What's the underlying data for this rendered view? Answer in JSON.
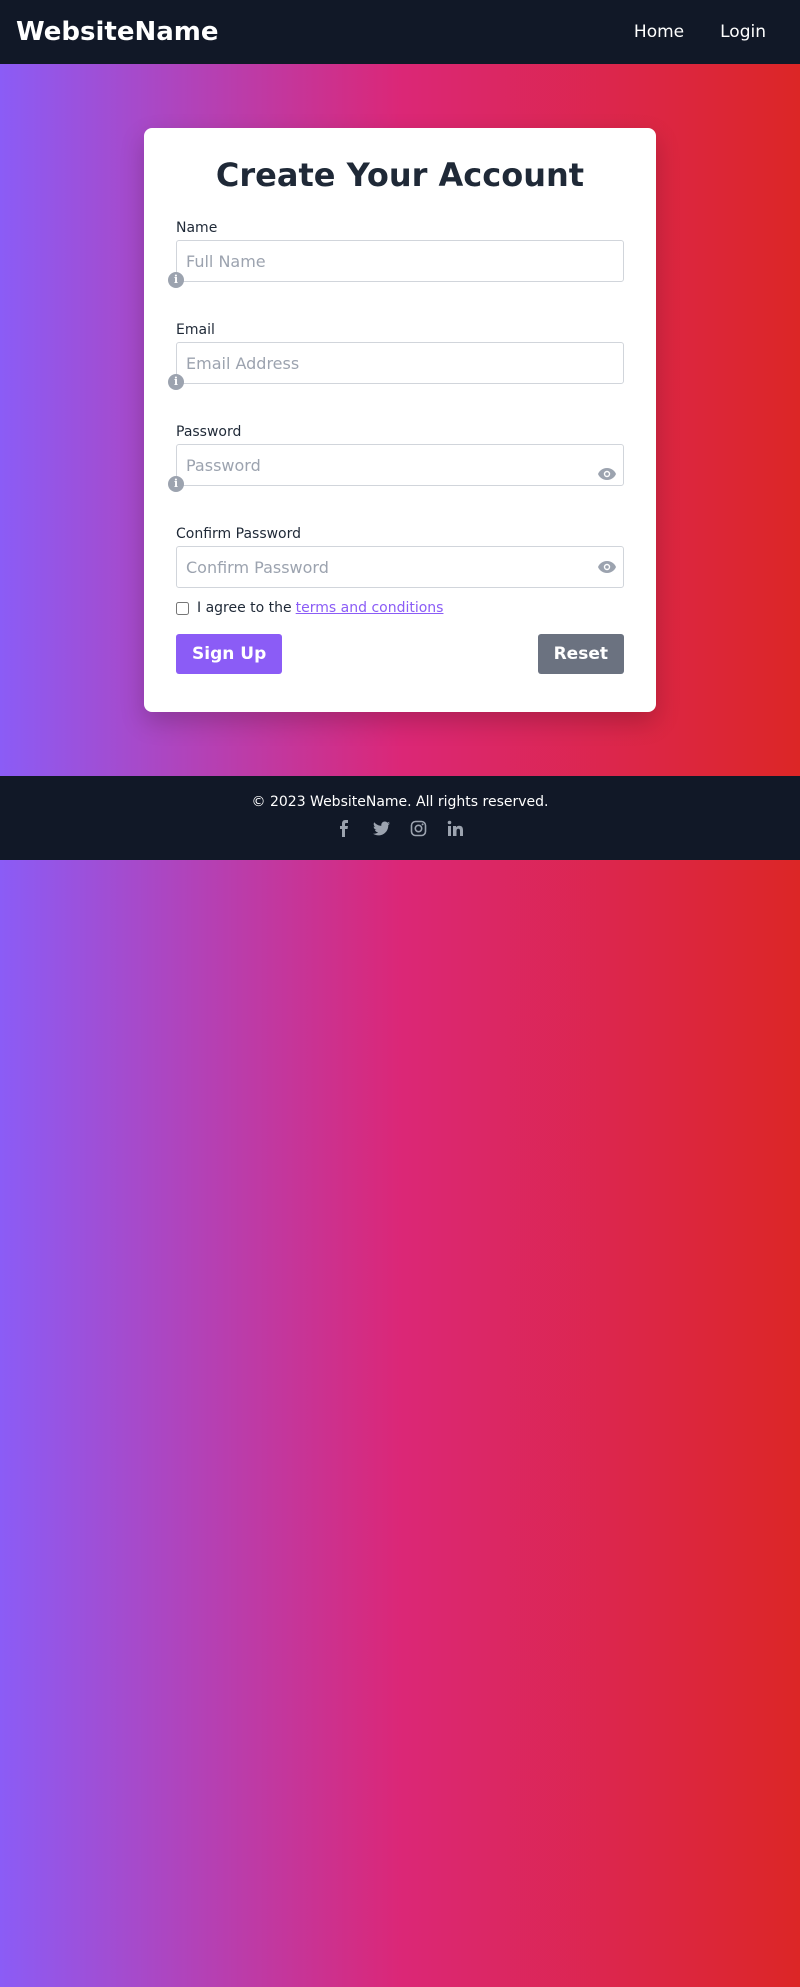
{
  "navbar": {
    "brand": "WebsiteName",
    "links": [
      {
        "label": "Home"
      },
      {
        "label": "Login"
      }
    ]
  },
  "form": {
    "title": "Create Your Account",
    "fields": [
      {
        "label": "Name",
        "placeholder": "Full Name",
        "value": ""
      },
      {
        "label": "Email",
        "placeholder": "Email Address",
        "value": ""
      },
      {
        "label": "Password",
        "placeholder": "Password",
        "value": ""
      },
      {
        "label": "Confirm Password",
        "placeholder": "Confirm Password",
        "value": ""
      }
    ],
    "agree_prefix": "I agree to the",
    "terms_link": "terms and conditions",
    "agree_checked": false,
    "signup_label": "Sign Up",
    "reset_label": "Reset"
  },
  "footer": {
    "copyright": "© 2023 WebsiteName. All rights reserved.",
    "social": [
      "facebook-icon",
      "twitter-icon",
      "instagram-icon",
      "linkedin-icon"
    ]
  },
  "colors": {
    "gradient_start": "#8b5cf6",
    "gradient_mid": "#db2777",
    "gradient_end": "#dc2626",
    "navbar_bg": "#111827",
    "primary": "#8b5cf6",
    "secondary": "#6b7280"
  }
}
